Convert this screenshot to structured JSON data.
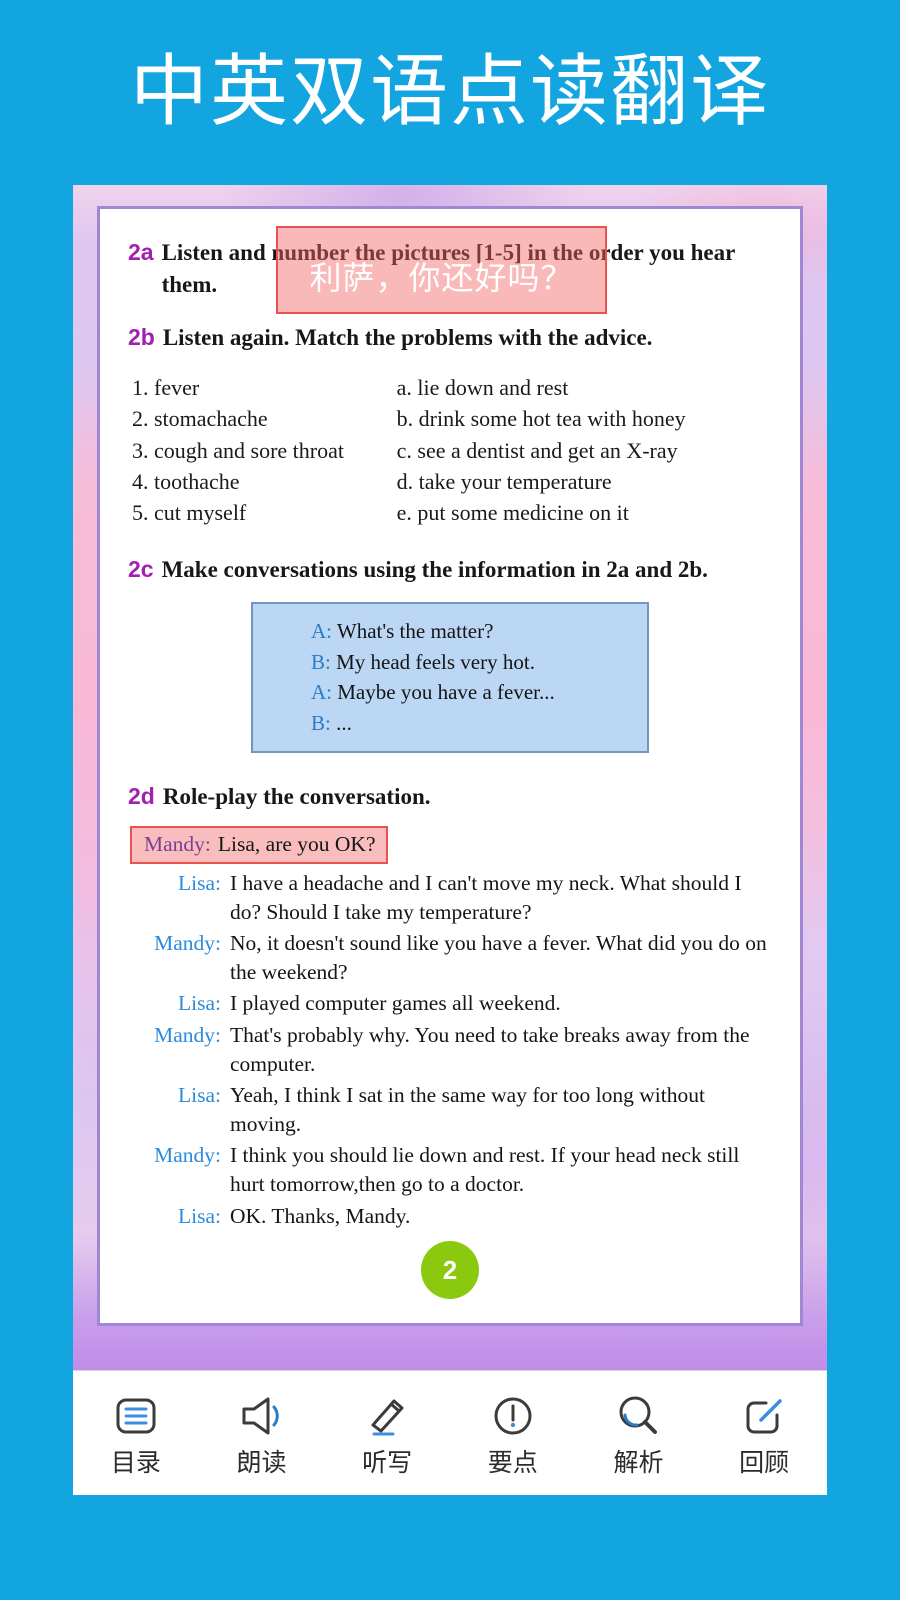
{
  "header": {
    "title": "中英双语点读翻译"
  },
  "lesson": {
    "sections": [
      {
        "label": "2a",
        "text": "Listen and number the pictures [1-5] in the order you hear them."
      },
      {
        "label": "2b",
        "text": "Listen again. Match the problems with the advice."
      },
      {
        "label": "2c",
        "text": "Make conversations using the information in 2a and 2b."
      },
      {
        "label": "2d",
        "text": "Role-play the conversation."
      }
    ],
    "match": {
      "problems": [
        "1. fever",
        "2. stomachache",
        "3. cough and sore throat",
        "4. toothache",
        "5. cut myself"
      ],
      "advice": [
        "a. lie down and rest",
        "b. drink some hot tea with honey",
        "c. see a dentist and get an X-ray",
        "d. take your temperature",
        "e. put some medicine on it"
      ]
    },
    "sample_conversation": [
      {
        "speaker": "A:",
        "text": "What's the matter?"
      },
      {
        "speaker": "B:",
        "text": "My head feels very hot."
      },
      {
        "speaker": "A:",
        "text": "Maybe you have a fever..."
      },
      {
        "speaker": "B:",
        "text": "..."
      }
    ],
    "roleplay": [
      {
        "speaker": "Mandy:",
        "text": "Lisa, are you OK?",
        "highlighted": true
      },
      {
        "speaker": "Lisa:",
        "text": "I have a headache and I can't move my neck. What should I do? Should I take my temperature?",
        "highlighted": false
      },
      {
        "speaker": "Mandy:",
        "text": "No, it doesn't sound like you have a fever. What did you do on the weekend?",
        "highlighted": false
      },
      {
        "speaker": "Lisa:",
        "text": "I played computer games all weekend.",
        "highlighted": false
      },
      {
        "speaker": "Mandy:",
        "text": "That's probably why. You need to take breaks away from the computer.",
        "highlighted": false
      },
      {
        "speaker": "Lisa:",
        "text": "Yeah, I think I sat in the same way for too long without moving.",
        "highlighted": false
      },
      {
        "speaker": "Mandy:",
        "text": "I think you should lie down and rest. If your head neck still hurt tomorrow,then go to a doctor.",
        "highlighted": false
      },
      {
        "speaker": "Lisa:",
        "text": "OK. Thanks, Mandy.",
        "highlighted": false
      }
    ],
    "page_number": "2"
  },
  "translation_popup": {
    "text": "利萨，你还好吗？"
  },
  "toolbar": {
    "items": [
      {
        "icon": "list-menu-icon",
        "label": "目录"
      },
      {
        "icon": "speaker-icon",
        "label": "朗读"
      },
      {
        "icon": "pencil-icon",
        "label": "听写"
      },
      {
        "icon": "exclamation-circle-icon",
        "label": "要点"
      },
      {
        "icon": "magnifier-icon",
        "label": "解析"
      },
      {
        "icon": "edit-square-icon",
        "label": "回顾"
      }
    ]
  },
  "colors": {
    "app_background": "#12A5E0",
    "section_label": "#A020B0",
    "speaker_blue": "#2C8BDC",
    "highlight_red": "#e8524f",
    "convo_box": "#BBD7F4",
    "page_badge_green": "#8BC90E",
    "frame_purple": "#9f87d4"
  }
}
